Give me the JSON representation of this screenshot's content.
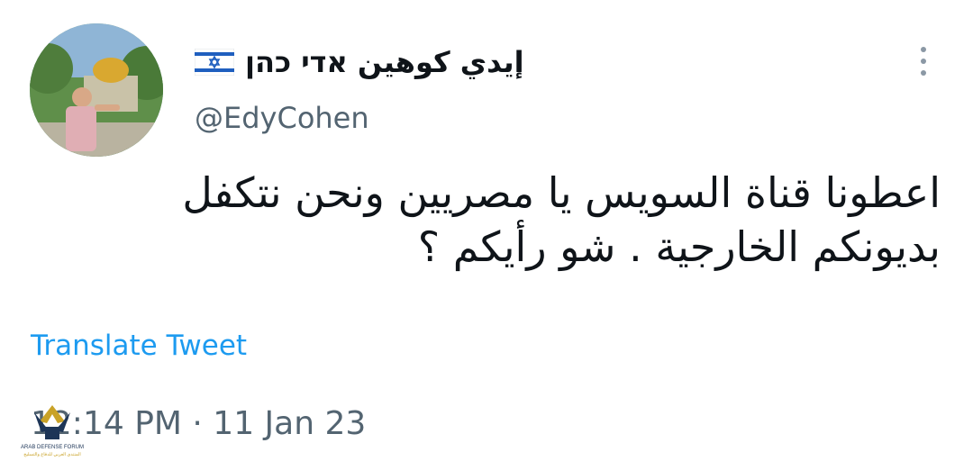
{
  "tweet": {
    "display_name": "إيدي كوهين אדי כהן",
    "handle": "@EdyCohen",
    "text_lines": [
      "اعطونا قناة السويس يا مصريين ونحن نتكفل",
      "بديونكم الخارجية . شو رأيكم ؟"
    ],
    "translate_label": "Translate Tweet",
    "timestamp": "12:14 PM · 11 Jan 23",
    "flag_icon": "israel-flag-icon",
    "colors": {
      "text": "#0f1419",
      "secondary": "#536471",
      "link": "#1d9bf0"
    }
  },
  "watermark": {
    "title": "ARAB DEFENSE FORUM",
    "subtitle": "المنتدى العربي للدفاع والتسليح"
  }
}
